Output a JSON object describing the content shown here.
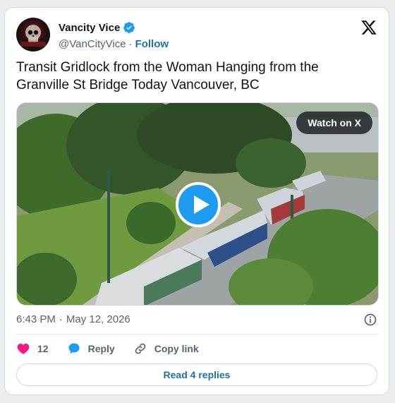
{
  "author": {
    "display_name": "Vancity Vice",
    "handle": "@VanCityVice",
    "follow_label": "Follow",
    "verified": true
  },
  "tweet": {
    "text": "Transit Gridlock from the Woman Hanging from the Granville St Bridge Today Vancouver, BC",
    "time": "6:43 PM",
    "date": "May 12, 2026"
  },
  "media": {
    "watch_label": "Watch on X",
    "play_icon": "play-icon"
  },
  "actions": {
    "like_count": "12",
    "reply_label": "Reply",
    "copy_link_label": "Copy link",
    "read_replies_label": "Read 4 replies"
  },
  "colors": {
    "accent": "#1d9bf0",
    "link": "#1d6fb3",
    "like": "#f91880",
    "muted": "#536471"
  }
}
